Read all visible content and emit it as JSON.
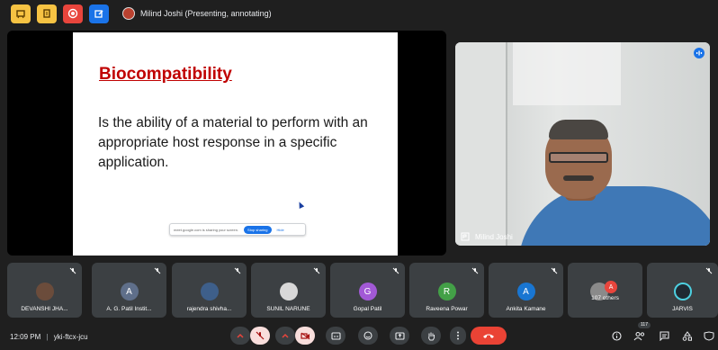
{
  "app": {
    "name": "Google Meet"
  },
  "presenting_label": "Milind Joshi (Presenting, annotating)",
  "colors": {
    "accent_blue": "#1a73e8",
    "end_call_red": "#ea4335",
    "tile_bg": "#3c4043",
    "slide_title_red": "#c00000",
    "yellow_tool": "#f6c343",
    "red_tool": "#e8453c"
  },
  "top_tools": [
    {
      "icon": "whiteboard-icon",
      "color": "#f6c343"
    },
    {
      "icon": "notes-icon",
      "color": "#f6c343"
    },
    {
      "icon": "record-icon",
      "color": "#e8453c"
    },
    {
      "icon": "edit-icon",
      "color": "#1a73e8"
    }
  ],
  "slide": {
    "title": "Biocompatibility",
    "body": "Is the ability of a material to perform with an appropriate host response in a specific application.",
    "share_notice": "meet.google.com is sharing your screen.",
    "stop_label": "Stop sharing",
    "hide_label": "Hide"
  },
  "speaker": {
    "name": "Milind Joshi"
  },
  "participants": [
    {
      "name": "DEVANSHI JHA...",
      "avatar_type": "photo",
      "avatar_color": "#6b4c3b"
    },
    {
      "name": "A. G. Patil Instit...",
      "avatar_letter": "A",
      "avatar_color": "#5f6f8a"
    },
    {
      "name": "rajendra shivha...",
      "avatar_type": "photo",
      "avatar_color": "#3e5f8a"
    },
    {
      "name": "SUNIL NARUNE",
      "avatar_type": "photo",
      "avatar_color": "#d8d8d8"
    },
    {
      "name": "Gopal Patil",
      "avatar_letter": "G",
      "avatar_color": "#a259d6"
    },
    {
      "name": "Raveena Powar",
      "avatar_letter": "R",
      "avatar_color": "#43a047"
    },
    {
      "name": "Ankita Kamane",
      "avatar_letter": "A",
      "avatar_color": "#1976d2"
    },
    {
      "name": "107 others",
      "avatar_letter": "A",
      "avatar_color": "#e8453c"
    },
    {
      "name": "JARVIS",
      "avatar_type": "logo",
      "avatar_color": "#1f2a33"
    }
  ],
  "meeting": {
    "time": "12:09 PM",
    "separator": "|",
    "code": "yki-ftcx-jcu"
  },
  "people_count": "117"
}
